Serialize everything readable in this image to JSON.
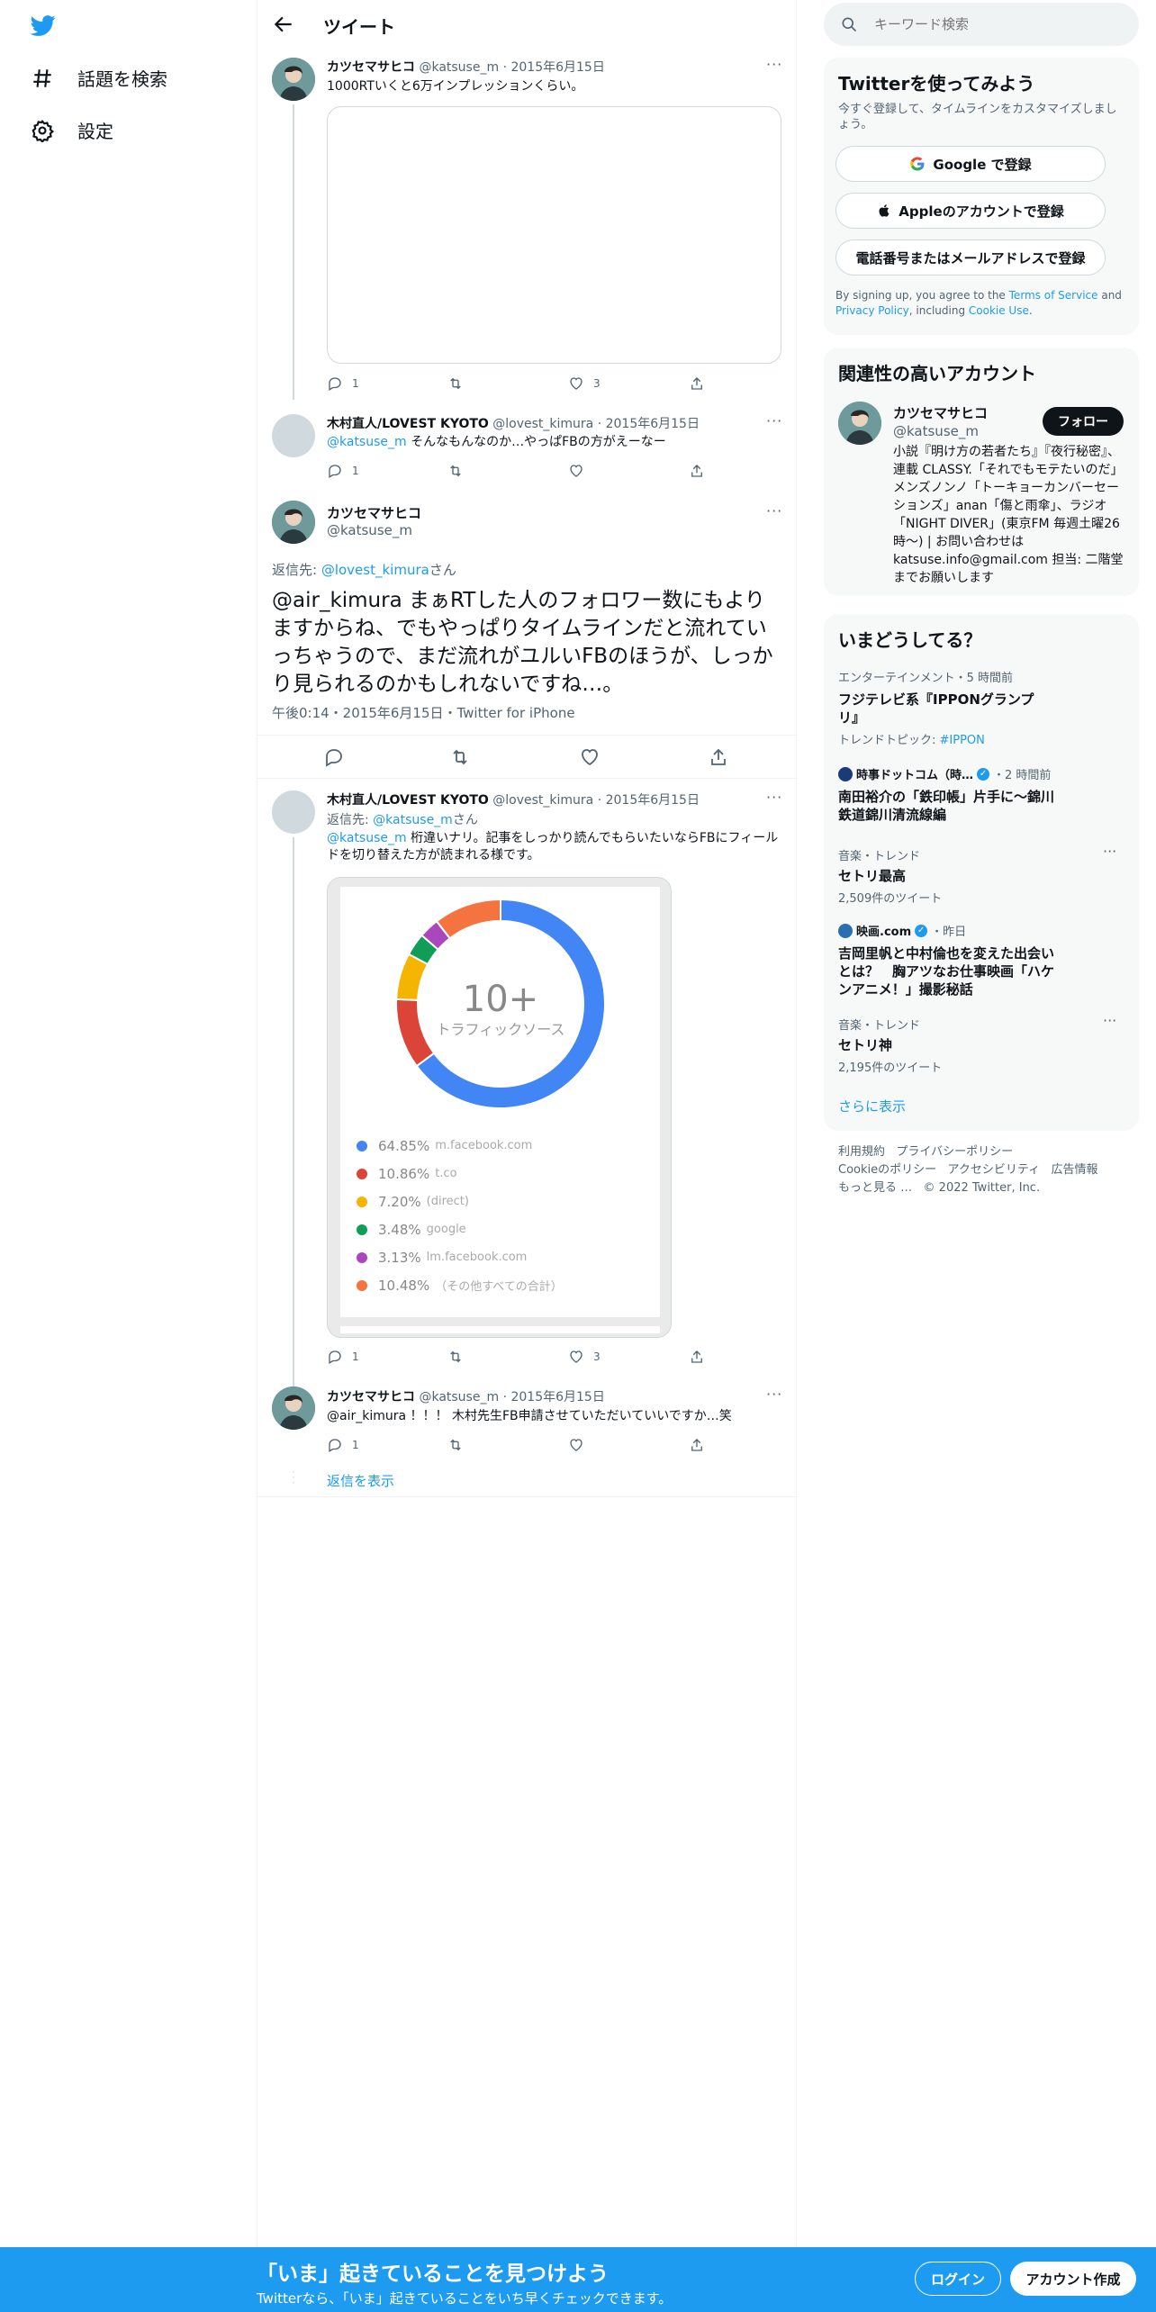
{
  "nav": {
    "explore_label": "話題を検索",
    "settings_label": "設定"
  },
  "header": {
    "title": "ツイート"
  },
  "tweets": [
    {
      "name": "カツセマサヒコ",
      "handle": "@katsuse_m",
      "date": "2015年6月15日",
      "text": "1000RTいくと6万インプレッションくらい。",
      "reply_count": "1",
      "retweet_count": "",
      "like_count": "3"
    },
    {
      "name": "木村直人/LOVEST KYOTO",
      "handle": "@lovest_kimura",
      "date": "2015年6月15日",
      "mention": "@katsuse_m",
      "text": " そんなもんなのか…やっぱFBの方がえーなー",
      "reply_count": "1"
    },
    {
      "name": "木村直人/LOVEST KYOTO",
      "handle": "@lovest_kimura",
      "date": "2015年6月15日",
      "replying_prefix": "返信先: ",
      "replying_to": "@katsuse_m",
      "replying_suffix": "さん",
      "mention": "@katsuse_m",
      "text": " 桁違いナリ。記事をしっかり読んでもらいたいならFBにフィールドを切り替えた方が読まれる様です。",
      "reply_count": "1",
      "like_count": "3"
    },
    {
      "name": "カツセマサヒコ",
      "handle": "@katsuse_m",
      "date": "2015年6月15日",
      "text": "@air_kimura ！！！ 木村先生FB申請させていただいていいですか…笑",
      "reply_count": "1"
    }
  ],
  "main_tweet": {
    "name": "カツセマサヒコ",
    "handle": "@katsuse_m",
    "replying_prefix": "返信先: ",
    "replying_to": "@lovest_kimura",
    "replying_suffix": "さん",
    "text": "@air_kimura まぁRTした人のフォロワー数にもよりますからね、でもやっぱりタイムラインだと流れていっちゃうので、まだ流れがユルいFBのほうが、しっかり見られるのかもしれないですね…。",
    "timestamp": "午後0:14・2015年6月15日・Twitter for iPhone"
  },
  "show_replies": "返信を表示",
  "chart_data": {
    "type": "pie",
    "center_value": "10+",
    "center_label": "トラフィックソース",
    "categories": [
      "m.facebook.com",
      "t.co",
      "(direct)",
      "google",
      "lm.facebook.com",
      "（その他すべての合計）"
    ],
    "values": [
      64.85,
      10.86,
      7.2,
      3.48,
      3.13,
      10.48
    ],
    "value_labels": [
      "64.85%",
      "10.86%",
      "7.20%",
      "3.48%",
      "3.13%",
      "10.48%"
    ],
    "colors": [
      "#4285f4",
      "#db4437",
      "#f4b400",
      "#0f9d58",
      "#ab47bc",
      "#f4733f"
    ]
  },
  "search": {
    "placeholder": "キーワード検索"
  },
  "signup": {
    "title": "Twitterを使ってみよう",
    "subtitle": "今すぐ登録して、タイムラインをカスタマイズしましょう。",
    "google": "Google で登録",
    "apple": "Appleのアカウントで登録",
    "phone": "電話番号またはメールアドレスで登録",
    "legal_1": "By signing up, you agree to the ",
    "tos": "Terms of Service",
    "legal_2": " and ",
    "privacy": "Privacy Policy",
    "legal_3": ", including ",
    "cookie": "Cookie Use",
    "legal_4": "."
  },
  "related": {
    "title": "関連性の高いアカウント",
    "name": "カツセマサヒコ",
    "handle": "@katsuse_m",
    "follow": "フォロー",
    "bio": "小説『明け方の若者たち』『夜行秘密』、連載 CLASSY.「それでもモテたいのだ」メンズノンノ「トーキョーカンバーセーションズ」anan「傷と雨傘」、ラジオ「NIGHT DIVER」(東京FM 毎週土曜26時〜) | お問い合わせは katsuse.info@gmail.com 担当: 二階堂までお願いします"
  },
  "trends": {
    "title": "いまどうしてる？",
    "items": [
      {
        "cat": "エンターテインメント・5 時間前",
        "title": "フジテレビ系『IPPONグランプリ』",
        "extra_prefix": "トレンドトピック: ",
        "extra_link": "#IPPON"
      },
      {
        "source": "時事ドットコム（時…",
        "time": "・2 時間前",
        "title": "南田裕介の「鉄印帳」片手に～錦川鉄道錦川清流線編"
      },
      {
        "cat": "音楽・トレンド",
        "title": "セトリ最高",
        "count": "2,509件のツイート"
      },
      {
        "source": "映画.com",
        "time": "・昨日",
        "title": "吉岡里帆と中村倫也を変えた出会いとは？　胸アツなお仕事映画「ハケンアニメ！」撮影秘話"
      },
      {
        "cat": "音楽・トレンド",
        "title": "セトリ神",
        "count": "2,195件のツイート"
      }
    ],
    "show_more": "さらに表示"
  },
  "footer": {
    "terms": "利用規約",
    "privacy": "プライバシーポリシー",
    "cookie": "Cookieのポリシー",
    "accessibility": "アクセシビリティ",
    "ads": "広告情報",
    "more": "もっと見る …",
    "copyright": "© 2022 Twitter, Inc."
  },
  "bottom": {
    "title": "「いま」起きていることを見つけよう",
    "subtitle": "Twitterなら、「いま」起きていることをいち早くチェックできます。",
    "login": "ログイン",
    "signup": "アカウント作成"
  },
  "colors": {
    "accent": "#1d9bf0",
    "text": "#0f1419",
    "muted": "#536471"
  }
}
